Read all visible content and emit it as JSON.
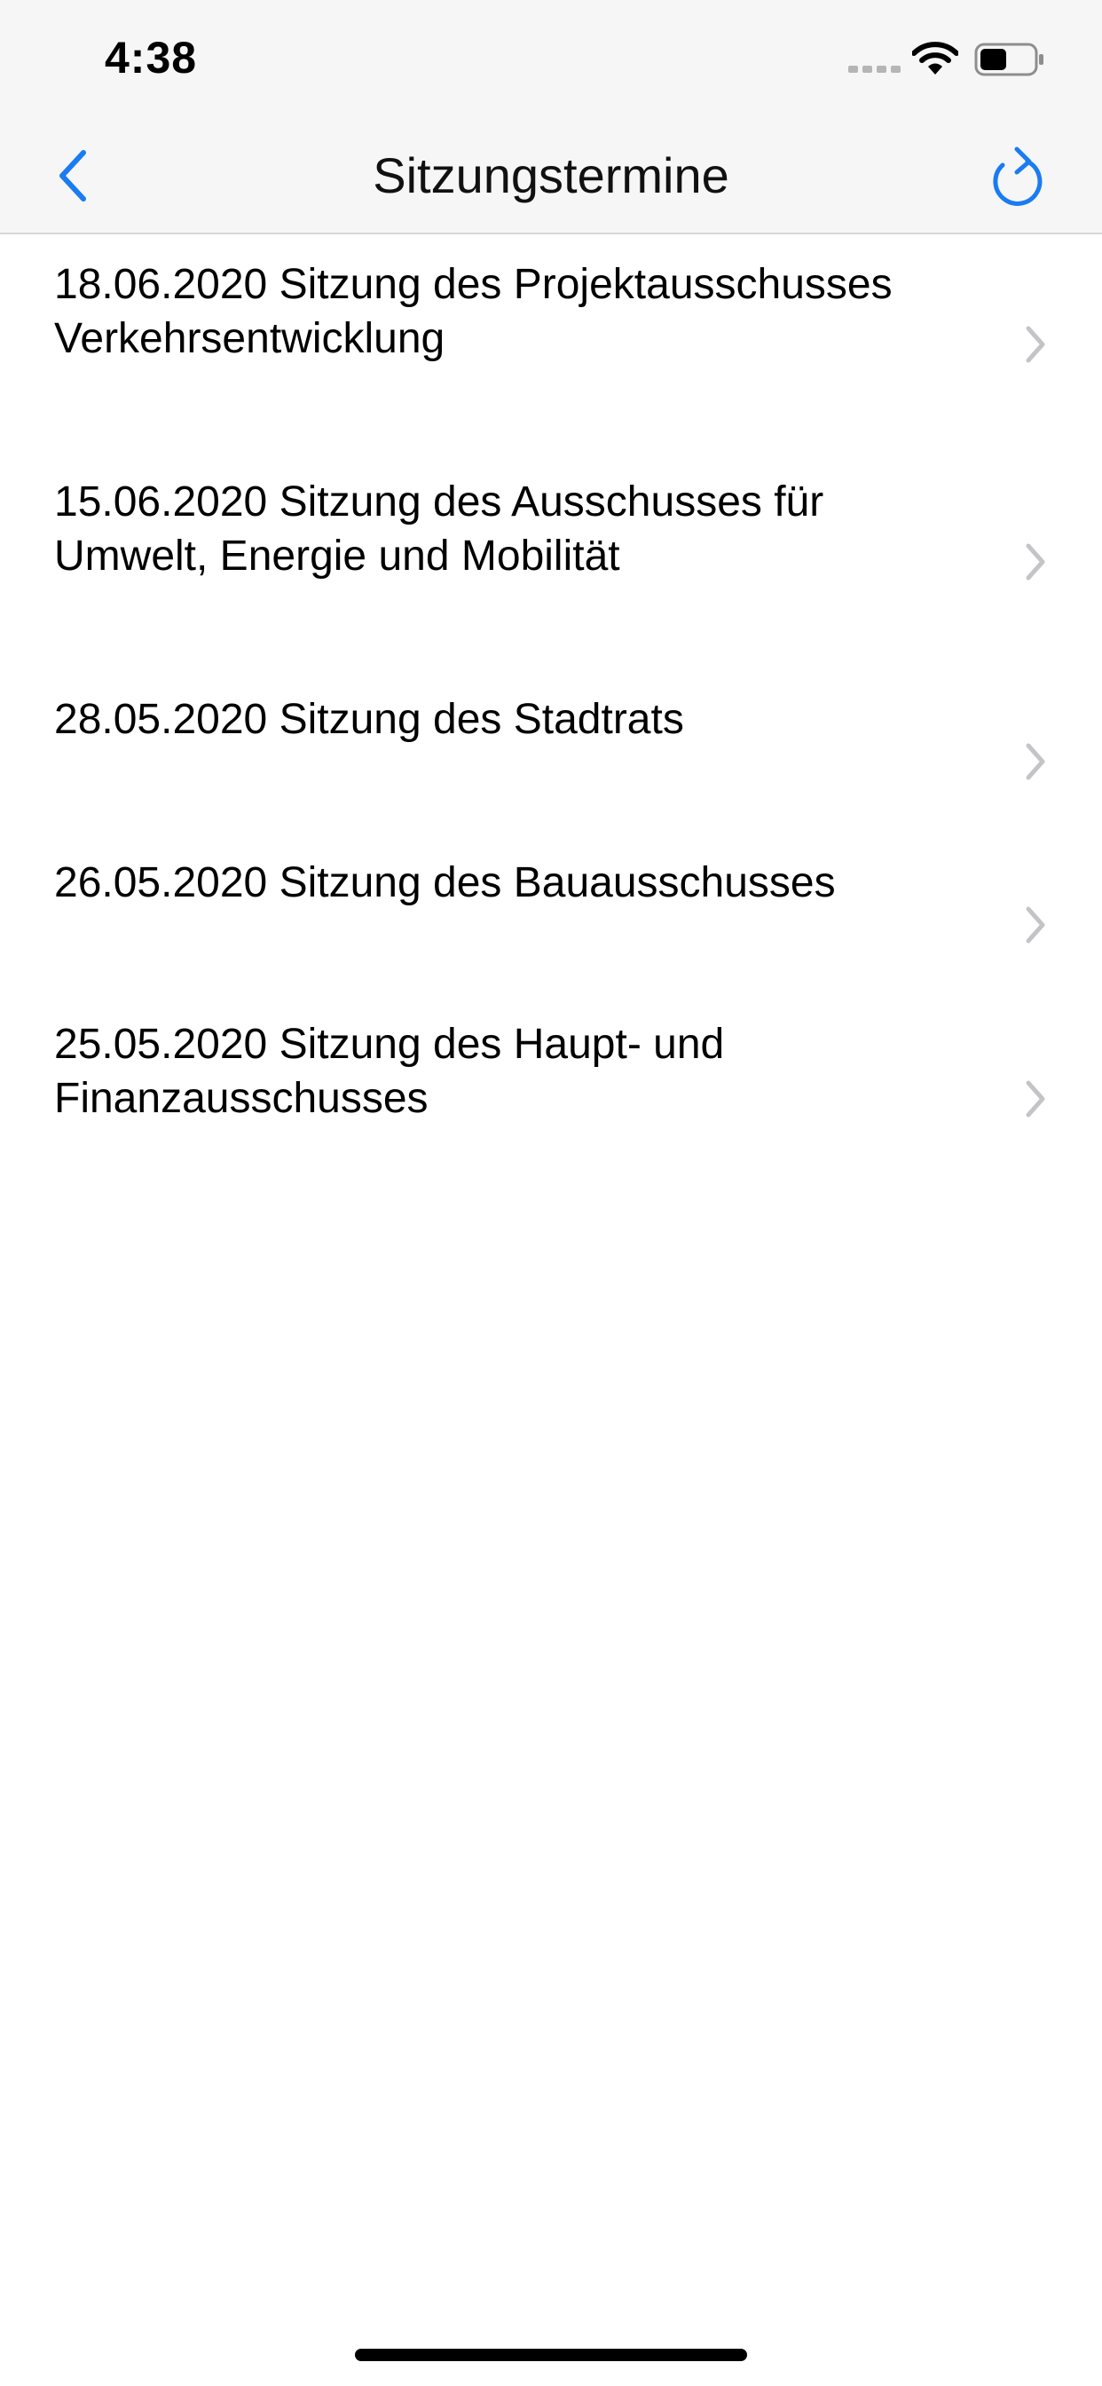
{
  "status_bar": {
    "time": "4:38",
    "signal_icon": "cellular-signal-icon",
    "wifi_icon": "wifi-icon",
    "battery_icon": "battery-icon",
    "battery_level": 0.5
  },
  "nav": {
    "title": "Sitzungstermine",
    "back_icon": "chevron-left-icon",
    "reload_icon": "reload-icon"
  },
  "meetings": [
    {
      "line1": "18.06.2020 Sitzung des Projektausschusses",
      "line2": "Verkehrsentwicklung"
    },
    {
      "line1": "15.06.2020 Sitzung des Ausschusses für",
      "line2": "Umwelt, Energie und Mobilität"
    },
    {
      "line1": "28.05.2020 Sitzung des Stadtrats",
      "line2": ""
    },
    {
      "line1": "26.05.2020 Sitzung des Bauausschusses",
      "line2": ""
    },
    {
      "line1": "25.05.2020 Sitzung des Haupt- und",
      "line2": "Finanzausschusses"
    }
  ],
  "colors": {
    "accent": "#1a7cf2",
    "chevron": "#c4c4c8",
    "nav_background": "#f6f6f6",
    "separator": "#d8d8d8"
  }
}
